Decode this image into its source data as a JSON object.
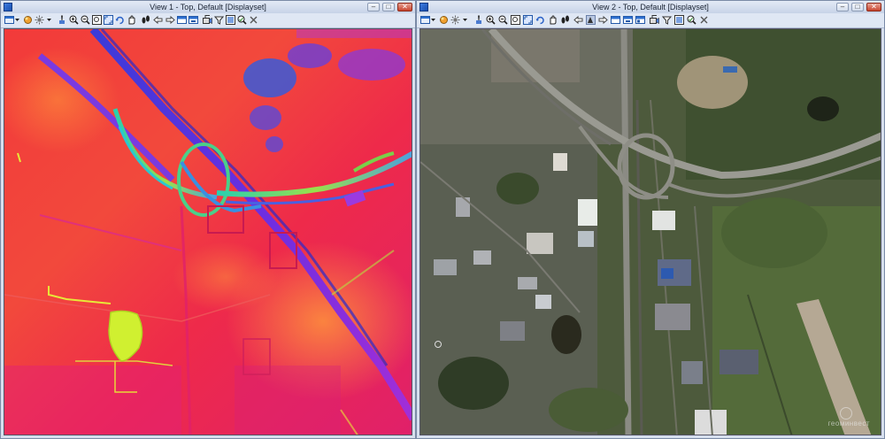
{
  "views": [
    {
      "title": "View 1 - Top, Default [Displayset]",
      "kind": "thermal"
    },
    {
      "title": "View 2 - Top, Default [Displayset]",
      "kind": "aerial",
      "watermark": "геоминвест"
    }
  ],
  "window_controls": {
    "minimize": "–",
    "maximize": "□",
    "close": "✕"
  },
  "toolbar_icons": [
    "view-attributes-icon",
    "dropdown-arrow-icon",
    "display-style-icon",
    "lighting-icon",
    "dropdown-arrow-icon",
    "clip-icon",
    "zoom-in-icon",
    "zoom-out-icon",
    "window-area-icon",
    "fit-view-icon",
    "rotate-view-icon",
    "pan-icon",
    "walk-icon",
    "view-previous-icon",
    "view-next-icon",
    "copy-view-icon",
    "save-view-icon",
    "camera-icon",
    "clip-volume-icon",
    "toggle-mask-icon",
    "view-settings-icon"
  ]
}
